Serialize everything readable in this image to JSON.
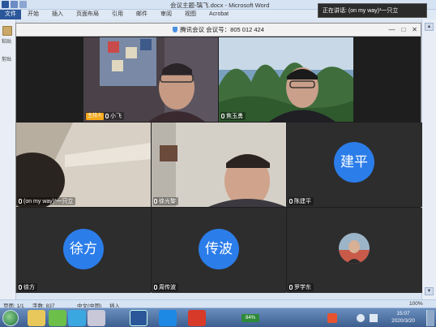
{
  "word": {
    "title": "会议主题-璃飞.docx - Microsoft Word",
    "tabs": [
      "文件",
      "开始",
      "插入",
      "页面布局",
      "引用",
      "邮件",
      "审阅",
      "视图",
      "Acrobat"
    ],
    "left_labels": [
      "粘贴",
      "剪贴"
    ],
    "status": {
      "page": "页面: 1/1",
      "words": "字数: 837",
      "lang": "中文(中国)",
      "mode": "插入",
      "zoom": "100%"
    }
  },
  "toast": {
    "text": "正在讲话: (on my way)³一只立"
  },
  "meeting": {
    "title": "腾讯会议 会议号：805 012 424",
    "window_buttons": [
      "—",
      "□",
      "✕"
    ],
    "participants": [
      {
        "name": "小飞",
        "host_badge": "主持人",
        "type": "video"
      },
      {
        "name": "焦玉勇",
        "type": "video"
      },
      {
        "name": "(on my way)³一只立",
        "type": "video"
      },
      {
        "name": "徐光黎",
        "type": "video"
      },
      {
        "name": "陈建平",
        "type": "avatar",
        "avatar_text": "建平",
        "avatar_color": "#2b7de9"
      },
      {
        "name": "徐方",
        "type": "avatar",
        "avatar_text": "徐方",
        "avatar_color": "#2b7de9"
      },
      {
        "name": "周传波",
        "type": "avatar",
        "avatar_text": "传波",
        "avatar_color": "#2b7de9"
      },
      {
        "name": "罗学东",
        "type": "photo"
      }
    ]
  },
  "taskbar": {
    "battery": "84%",
    "time": "15:07",
    "date": "2020/3/20",
    "tray_icons": [
      "sogou-icon",
      "network-icon",
      "volume-icon",
      "flag-icon"
    ]
  },
  "colors": {
    "word_blue": "#2b579a",
    "avatar_blue": "#2b7de9",
    "host_orange": "#f3a81c",
    "tile_bg": "#2d2d2d"
  }
}
